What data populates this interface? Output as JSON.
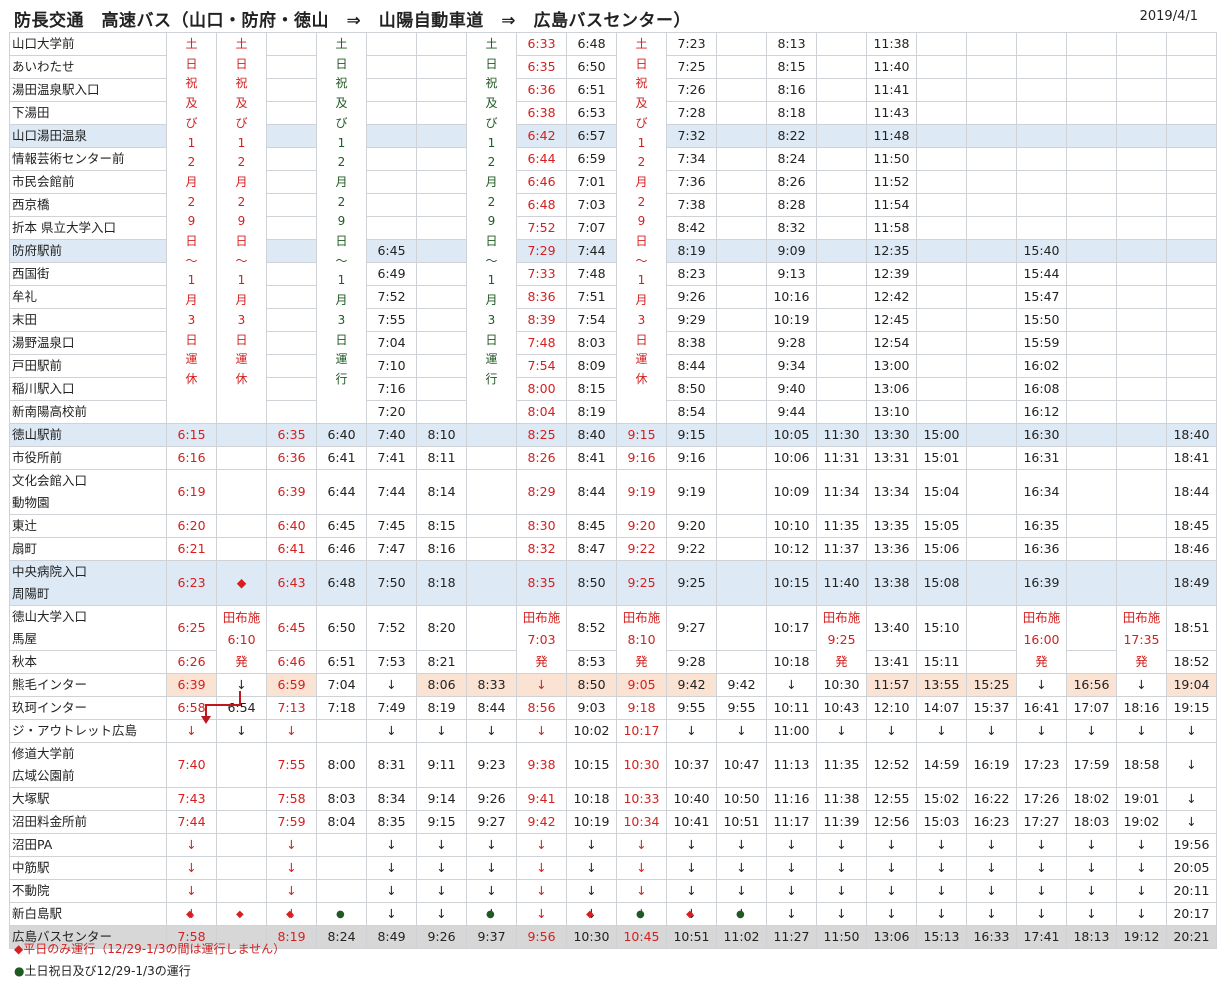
{
  "title": "防長交通　高速バス（山口・防府・徳山　⇒　山陽自動車道　⇒　広島バスセンター）",
  "date": "2019/4/1",
  "colors": {
    "weekday_red": "#d42020",
    "holiday_green": "#1f5a23",
    "highlight_blue": "#dde9f4",
    "highlight_pink": "#fbe3d4",
    "terminal_gray": "#d7d7d7"
  },
  "rows": [
    {
      "station": "山口大学前",
      "c": [
        "",
        "",
        "",
        "",
        "",
        "",
        "",
        "6:33",
        "6:48",
        "",
        "7:23",
        "",
        "8:13",
        "",
        "11:38",
        "",
        "",
        "",
        "",
        "",
        ""
      ]
    },
    {
      "station": "あいわたせ",
      "c": [
        "",
        "",
        "",
        "",
        "",
        "",
        "",
        "6:35",
        "6:50",
        "",
        "7:25",
        "",
        "8:15",
        "",
        "11:40",
        "",
        "",
        "",
        "",
        "",
        ""
      ]
    },
    {
      "station": "湯田温泉駅入口",
      "c": [
        "",
        "",
        "",
        "",
        "",
        "",
        "",
        "6:36",
        "6:51",
        "",
        "7:26",
        "",
        "8:16",
        "",
        "11:41",
        "",
        "",
        "",
        "",
        "",
        ""
      ]
    },
    {
      "station": "下湯田",
      "c": [
        "",
        "",
        "",
        "",
        "",
        "",
        "",
        "6:38",
        "6:53",
        "",
        "7:28",
        "",
        "8:18",
        "",
        "11:43",
        "",
        "",
        "",
        "",
        "",
        ""
      ]
    },
    {
      "station": "山口湯田温泉",
      "c": [
        "",
        "",
        "",
        "",
        "",
        "",
        "",
        "6:42",
        "6:57",
        "",
        "7:32",
        "",
        "8:22",
        "",
        "11:48",
        "",
        "",
        "",
        "",
        "",
        ""
      ]
    },
    {
      "station": "情報芸術センター前",
      "c": [
        "",
        "",
        "",
        "",
        "",
        "",
        "",
        "6:44",
        "6:59",
        "",
        "7:34",
        "",
        "8:24",
        "",
        "11:50",
        "",
        "",
        "",
        "",
        "",
        ""
      ]
    },
    {
      "station": "市民会館前",
      "c": [
        "",
        "",
        "",
        "",
        "",
        "",
        "",
        "6:46",
        "7:01",
        "",
        "7:36",
        "",
        "8:26",
        "",
        "11:52",
        "",
        "",
        "",
        "",
        "",
        ""
      ]
    },
    {
      "station": "西京橋",
      "c": [
        "",
        "",
        "",
        "",
        "",
        "",
        "",
        "6:48",
        "7:03",
        "",
        "7:38",
        "",
        "8:28",
        "",
        "11:54",
        "",
        "",
        "",
        "",
        "",
        ""
      ]
    },
    {
      "station": "折本 県立大学入口",
      "c": [
        "",
        "",
        "",
        "",
        "",
        "",
        "",
        "7:52",
        "7:07",
        "",
        "8:42",
        "",
        "8:32",
        "",
        "11:58",
        "",
        "",
        "",
        "",
        "",
        ""
      ]
    },
    {
      "station": "防府駅前",
      "c": [
        "",
        "",
        "",
        "",
        "6:45",
        "",
        "",
        "7:29",
        "7:44",
        "",
        "8:19",
        "",
        "9:09",
        "",
        "12:35",
        "",
        "",
        "15:40",
        "",
        "",
        ""
      ]
    },
    {
      "station": "西国街",
      "c": [
        "",
        "",
        "",
        "",
        "6:49",
        "",
        "",
        "7:33",
        "7:48",
        "",
        "8:23",
        "",
        "9:13",
        "",
        "12:39",
        "",
        "",
        "15:44",
        "",
        "",
        ""
      ]
    },
    {
      "station": "牟礼",
      "c": [
        "",
        "",
        "",
        "",
        "7:52",
        "",
        "",
        "8:36",
        "7:51",
        "",
        "9:26",
        "",
        "10:16",
        "",
        "12:42",
        "",
        "",
        "15:47",
        "",
        "",
        ""
      ]
    },
    {
      "station": "末田",
      "c": [
        "",
        "",
        "",
        "",
        "7:55",
        "",
        "",
        "8:39",
        "7:54",
        "",
        "9:29",
        "",
        "10:19",
        "",
        "12:45",
        "",
        "",
        "15:50",
        "",
        "",
        ""
      ]
    },
    {
      "station": "湯野温泉口",
      "c": [
        "",
        "",
        "",
        "",
        "7:04",
        "",
        "",
        "7:48",
        "8:03",
        "",
        "8:38",
        "",
        "9:28",
        "",
        "12:54",
        "",
        "",
        "15:59",
        "",
        "",
        ""
      ]
    },
    {
      "station": "戸田駅前",
      "c": [
        "",
        "",
        "",
        "",
        "7:10",
        "",
        "",
        "7:54",
        "8:09",
        "",
        "8:44",
        "",
        "9:34",
        "",
        "13:00",
        "",
        "",
        "16:02",
        "",
        "",
        ""
      ]
    },
    {
      "station": "稲川駅入口",
      "c": [
        "",
        "",
        "",
        "",
        "7:16",
        "",
        "",
        "8:00",
        "8:15",
        "",
        "8:50",
        "",
        "9:40",
        "",
        "13:06",
        "",
        "",
        "16:08",
        "",
        "",
        ""
      ]
    },
    {
      "station": "新南陽高校前",
      "c": [
        "",
        "",
        "",
        "",
        "7:20",
        "",
        "",
        "8:04",
        "8:19",
        "",
        "8:54",
        "",
        "9:44",
        "",
        "13:10",
        "",
        "",
        "16:12",
        "",
        "",
        ""
      ]
    },
    {
      "station": "徳山駅前",
      "c": [
        "6:15",
        "",
        "6:35",
        "6:40",
        "7:40",
        "8:10",
        "",
        "8:25",
        "8:40",
        "9:15",
        "9:15",
        "",
        "10:05",
        "11:30",
        "13:30",
        "15:00",
        "",
        "16:30",
        "",
        "",
        "18:40"
      ]
    },
    {
      "station": "市役所前",
      "c": [
        "6:16",
        "",
        "6:36",
        "6:41",
        "7:41",
        "8:11",
        "",
        "8:26",
        "8:41",
        "9:16",
        "9:16",
        "",
        "10:06",
        "11:31",
        "13:31",
        "15:01",
        "",
        "16:31",
        "",
        "",
        "18:41"
      ]
    },
    {
      "station": "文化会館入口\n動物園",
      "c": [
        "6:19",
        "",
        "6:39",
        "6:44",
        "7:44",
        "8:14",
        "",
        "8:29",
        "8:44",
        "9:19",
        "9:19",
        "",
        "10:09",
        "11:34",
        "13:34",
        "15:04",
        "",
        "16:34",
        "",
        "",
        "18:44"
      ]
    },
    {
      "station": "東辻",
      "c": [
        "6:20",
        "",
        "6:40",
        "6:45",
        "7:45",
        "8:15",
        "",
        "8:30",
        "8:45",
        "9:20",
        "9:20",
        "",
        "10:10",
        "11:35",
        "13:35",
        "15:05",
        "",
        "16:35",
        "",
        "",
        "18:45"
      ]
    },
    {
      "station": "扇町",
      "c": [
        "6:21",
        "",
        "6:41",
        "6:46",
        "7:47",
        "8:16",
        "",
        "8:32",
        "8:47",
        "9:22",
        "9:22",
        "",
        "10:12",
        "11:37",
        "13:36",
        "15:06",
        "",
        "16:36",
        "",
        "",
        "18:46"
      ]
    },
    {
      "station": "中央病院入口\n周陽町",
      "c": [
        "6:23",
        "◆",
        "6:43",
        "6:48",
        "7:50",
        "8:18",
        "",
        "8:35",
        "8:50",
        "9:25",
        "9:25",
        "",
        "10:15",
        "11:40",
        "13:38",
        "15:08",
        "",
        "16:39",
        "",
        "",
        "18:49"
      ]
    },
    {
      "station": "徳山大学入口\n馬屋",
      "c": [
        "6:25",
        "",
        "6:45",
        "6:50",
        "7:52",
        "8:20",
        "",
        "8:37",
        "8:52",
        "9:27",
        "9:27",
        "",
        "10:17",
        "11:42",
        "13:40",
        "15:10",
        "",
        "16:41",
        "",
        "",
        "18:51"
      ]
    },
    {
      "station": "秋本",
      "c": [
        "6:26",
        "",
        "6:46",
        "6:51",
        "7:53",
        "8:21",
        "",
        "8:38",
        "8:53",
        "9:28",
        "9:28",
        "",
        "10:18",
        "11:43",
        "13:41",
        "15:11",
        "",
        "16:42",
        "",
        "",
        "18:52"
      ]
    },
    {
      "station": "熊毛インター",
      "c": [
        "6:39",
        "↓",
        "6:59",
        "7:04",
        "↓",
        "8:06",
        "8:33",
        "↓",
        "8:50",
        "9:05",
        "9:42",
        "9:42",
        "↓",
        "10:30",
        "11:57",
        "13:55",
        "15:25",
        "↓",
        "16:56",
        "↓",
        "19:04"
      ]
    },
    {
      "station": "玖珂インター",
      "c": [
        "6:58",
        "6:54",
        "7:13",
        "7:18",
        "7:49",
        "8:19",
        "8:44",
        "8:56",
        "9:03",
        "9:18",
        "9:55",
        "9:55",
        "10:11",
        "10:43",
        "12:10",
        "14:07",
        "15:37",
        "16:41",
        "17:07",
        "18:16",
        "19:15"
      ]
    },
    {
      "station": "ジ・アウトレット広島",
      "c": [
        "↓",
        "↓",
        "↓",
        "",
        "↓",
        "↓",
        "↓",
        "↓",
        "10:02",
        "10:17",
        "↓",
        "↓",
        "11:00",
        "↓",
        "↓",
        "↓",
        "↓",
        "↓",
        "↓",
        "↓",
        "↓"
      ]
    },
    {
      "station": "修道大学前\n広域公園前",
      "c": [
        "7:40",
        "",
        "7:55",
        "8:00",
        "8:31",
        "9:11",
        "9:23",
        "9:38",
        "10:15",
        "10:30",
        "10:37",
        "10:47",
        "11:13",
        "11:35",
        "12:52",
        "14:59",
        "16:19",
        "17:23",
        "17:59",
        "18:58",
        "↓"
      ]
    },
    {
      "station": "大塚駅",
      "c": [
        "7:43",
        "",
        "7:58",
        "8:03",
        "8:34",
        "9:14",
        "9:26",
        "9:41",
        "10:18",
        "10:33",
        "10:40",
        "10:50",
        "11:16",
        "11:38",
        "12:55",
        "15:02",
        "16:22",
        "17:26",
        "18:02",
        "19:01",
        "↓"
      ]
    },
    {
      "station": "沼田料金所前",
      "c": [
        "7:44",
        "",
        "7:59",
        "8:04",
        "8:35",
        "9:15",
        "9:27",
        "9:42",
        "10:19",
        "10:34",
        "10:41",
        "10:51",
        "11:17",
        "11:39",
        "12:56",
        "15:03",
        "16:23",
        "17:27",
        "18:03",
        "19:02",
        "↓"
      ]
    },
    {
      "station": "沼田PA",
      "c": [
        "↓",
        "",
        "↓",
        "",
        "↓",
        "↓",
        "↓",
        "↓",
        "↓",
        "↓",
        "↓",
        "↓",
        "↓",
        "↓",
        "↓",
        "↓",
        "↓",
        "↓",
        "↓",
        "↓",
        "19:56"
      ]
    },
    {
      "station": "中筋駅",
      "c": [
        "↓",
        "",
        "↓",
        "",
        "↓",
        "↓",
        "↓",
        "↓",
        "↓",
        "↓",
        "↓",
        "↓",
        "↓",
        "↓",
        "↓",
        "↓",
        "↓",
        "↓",
        "↓",
        "↓",
        "20:05"
      ]
    },
    {
      "station": "不動院",
      "c": [
        "↓",
        "",
        "↓",
        "",
        "↓",
        "↓",
        "↓",
        "↓",
        "↓",
        "↓",
        "↓",
        "↓",
        "↓",
        "↓",
        "↓",
        "↓",
        "↓",
        "↓",
        "↓",
        "↓",
        "20:11"
      ]
    },
    {
      "station": "新白島駅",
      "c": [
        "↓",
        "",
        "↓",
        "",
        "↓",
        "↓",
        "↓",
        "↓",
        "↓",
        "↓",
        "↓",
        "↓",
        "↓",
        "↓",
        "↓",
        "↓",
        "↓",
        "↓",
        "↓",
        "↓",
        "20:17"
      ]
    },
    {
      "station": "広島バスセンター",
      "c": [
        "7:58",
        "",
        "8:19",
        "8:24",
        "8:49",
        "9:26",
        "9:37",
        "9:56",
        "10:30",
        "10:45",
        "10:51",
        "11:02",
        "11:27",
        "11:50",
        "13:06",
        "15:13",
        "16:33",
        "17:41",
        "18:13",
        "19:12",
        "20:21"
      ]
    }
  ],
  "vertical_notes": [
    {
      "col": 0,
      "text": "土日祝及び12月29日～1月3日運休",
      "color": "red"
    },
    {
      "col": 1,
      "text": "土日祝及び12月29日～1月3日運休",
      "color": "red"
    },
    {
      "col": 3,
      "text": "土日祝及び12月29日～1月3日運行",
      "color": "green"
    },
    {
      "col": 6,
      "text": "土日祝及び12月29日～1月3日運行",
      "color": "green"
    },
    {
      "col": 9,
      "text": "土日祝及び12月29日～1月3日運休",
      "color": "red"
    }
  ],
  "origin_notes": [
    {
      "col": 1,
      "lines": [
        "田布施",
        "6:10",
        "発"
      ]
    },
    {
      "col": 7,
      "lines": [
        "田布施",
        "7:03",
        "発"
      ]
    },
    {
      "col": 9,
      "lines": [
        "田布施",
        "8:10",
        "発"
      ]
    },
    {
      "col": 13,
      "lines": [
        "田布施",
        "9:25",
        "発"
      ]
    },
    {
      "col": 17,
      "lines": [
        "田布施",
        "16:00",
        "発"
      ]
    },
    {
      "col": 19,
      "lines": [
        "田布施",
        "17:35",
        "発"
      ]
    }
  ],
  "footer_marks": [
    "◆",
    "◆",
    "◆",
    "●",
    "",
    "",
    "●",
    "",
    "◆",
    "●",
    "◆",
    "●",
    "",
    "",
    "",
    "",
    "",
    "",
    "",
    "",
    ""
  ],
  "legend": [
    {
      "mark": "◆",
      "text": "平日のみ運行（12/29-1/3の間は運行しません）",
      "color": "red"
    },
    {
      "mark": "●",
      "text": "土日祝日及び12/29-1/3の運行",
      "color": "green"
    }
  ]
}
